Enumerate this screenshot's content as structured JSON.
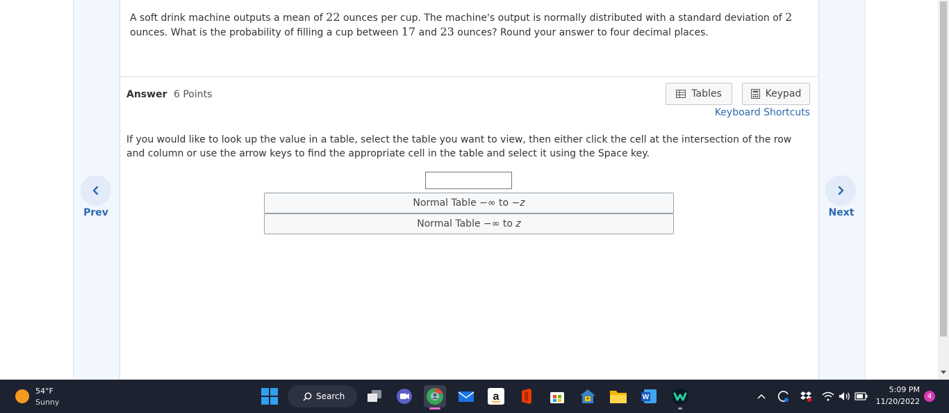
{
  "question": {
    "parts": [
      {
        "text": "A soft drink machine outputs a mean of ",
        "math": false
      },
      {
        "text": "22",
        "math": true
      },
      {
        "text": " ounces per cup. The machine's output is normally distributed with a standard deviation of ",
        "math": false
      },
      {
        "text": "2",
        "math": true
      },
      {
        "text": " ounces. What is the probability of filling a cup between ",
        "math": false
      },
      {
        "text": "17",
        "math": true
      },
      {
        "text": " and ",
        "math": false
      },
      {
        "text": "23",
        "math": true
      },
      {
        "text": " ounces? Round your answer to four decimal places.",
        "math": false
      }
    ]
  },
  "answer": {
    "label": "Answer",
    "points": "6 Points",
    "tables_button": "Tables",
    "keypad_button": "Keypad",
    "keyboard_shortcuts": "Keyboard Shortcuts",
    "instructions": "If you would like to look up the value in a table, select the table you want to view, then either click the cell at the intersection of the row and column or use the arrow keys to find the appropriate cell in the table and select it using the Space key.",
    "input_value": "",
    "table_options": [
      {
        "prefix": "Normal Table −∞ to ",
        "var": "−z"
      },
      {
        "prefix": "Normal Table −∞ to ",
        "var": "z"
      }
    ]
  },
  "nav": {
    "prev_label": "Prev",
    "next_label": "Next"
  },
  "taskbar": {
    "weather_temp": "54°F",
    "weather_condition": "Sunny",
    "search_label": "Search",
    "time": "5:09 PM",
    "date": "11/20/2022",
    "notification_count": "4",
    "apps": [
      {
        "icon": "windows-start-icon"
      },
      {
        "icon": "task-view-icon"
      },
      {
        "icon": "video-chat-icon"
      },
      {
        "icon": "chrome-profile-icon"
      },
      {
        "icon": "mail-icon"
      },
      {
        "icon": "amazon-icon",
        "glyph": "a"
      },
      {
        "icon": "office-icon"
      },
      {
        "icon": "store-icon"
      },
      {
        "icon": "security-app-icon"
      },
      {
        "icon": "file-explorer-icon"
      },
      {
        "icon": "word-icon",
        "glyph": "W"
      },
      {
        "icon": "webex-icon"
      }
    ]
  },
  "colors": {
    "link": "#2d6aad",
    "side_panel": "#f2f6fd",
    "taskbar": "#1d2230",
    "weather_sun": "#f59a1f",
    "notification": "#d63ab3"
  }
}
